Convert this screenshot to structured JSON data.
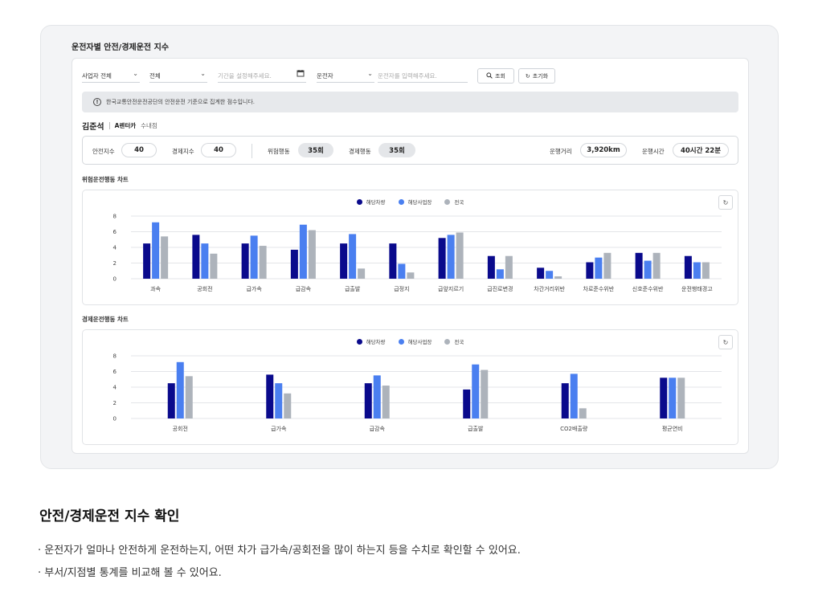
{
  "frame_title": "운전자별 안전/경제운전 지수",
  "filters": {
    "company": "사업자 전체",
    "scope": "전체",
    "date_placeholder": "기간을 설정해주세요.",
    "driver_select": "운전자",
    "driver_placeholder": "운전자를 입력해주세요.",
    "search_label": "조회",
    "reset_label": "초기화"
  },
  "notice": "한국교통안전운전공단의 안전운전 기준으로 집계한 점수입니다.",
  "driver": {
    "name": "김준석",
    "company": "A렌터카",
    "branch": "수내점"
  },
  "stats": {
    "safety_label": "안전지수",
    "safety_value": "40",
    "economy_label": "경제지수",
    "economy_value": "40",
    "risk_label": "위험행동",
    "risk_value": "35회",
    "eco_label": "경제행동",
    "eco_value": "35회",
    "distance_label": "운행거리",
    "distance_value": "3,920km",
    "time_label": "운행시간",
    "time_value": "40시간 22분"
  },
  "legend": [
    "해당차량",
    "해당사업장",
    "전국"
  ],
  "colors": {
    "vehicle": "#0a0a8c",
    "business": "#4a7ff0",
    "national": "#adb3bb"
  },
  "chart_data": [
    {
      "type": "bar",
      "title": "위험운전행동 차트",
      "categories": [
        "과속",
        "공회전",
        "급가속",
        "급감속",
        "급출발",
        "급정지",
        "급앞지르기",
        "급진로변경",
        "차간거리위반",
        "차로준수위반",
        "신호준수위반",
        "운전행태경고"
      ],
      "ylim": [
        0,
        8
      ],
      "yticks": [
        0,
        2,
        4,
        6,
        8
      ],
      "series": [
        {
          "name": "해당차량",
          "values": [
            4.5,
            5.6,
            4.5,
            3.7,
            4.5,
            4.5,
            5.2,
            2.9,
            1.4,
            2.1,
            3.3,
            2.9
          ]
        },
        {
          "name": "해당사업장",
          "values": [
            7.2,
            4.5,
            5.5,
            6.9,
            5.7,
            1.9,
            5.6,
            1.2,
            1.0,
            2.7,
            2.3,
            2.1
          ]
        },
        {
          "name": "전국",
          "values": [
            5.4,
            3.2,
            4.2,
            6.2,
            1.3,
            0.8,
            5.9,
            2.9,
            0.3,
            3.3,
            3.3,
            2.1
          ]
        }
      ]
    },
    {
      "type": "bar",
      "title": "경제운전행동 차트",
      "categories": [
        "공회전",
        "급가속",
        "급감속",
        "급출발",
        "CO2배출량",
        "평균연비"
      ],
      "ylim": [
        0,
        8
      ],
      "yticks": [
        0,
        2,
        4,
        6,
        8
      ],
      "series": [
        {
          "name": "해당차량",
          "values": [
            4.5,
            5.6,
            4.5,
            3.7,
            4.5,
            5.2
          ]
        },
        {
          "name": "해당사업장",
          "values": [
            7.2,
            4.5,
            5.5,
            6.9,
            5.7,
            5.2
          ]
        },
        {
          "name": "전국",
          "values": [
            5.4,
            3.2,
            4.2,
            6.2,
            1.3,
            5.2
          ]
        }
      ]
    }
  ],
  "bottom": {
    "heading": "안전/경제운전 지수 확인",
    "bullet1": "· 운전자가 얼마나 안전하게 운전하는지, 어떤 차가 급가속/공회전을 많이 하는지 등을 수치로 확인할 수 있어요.",
    "bullet2": "· 부서/지점별 통계를 비교해 볼 수 있어요."
  }
}
